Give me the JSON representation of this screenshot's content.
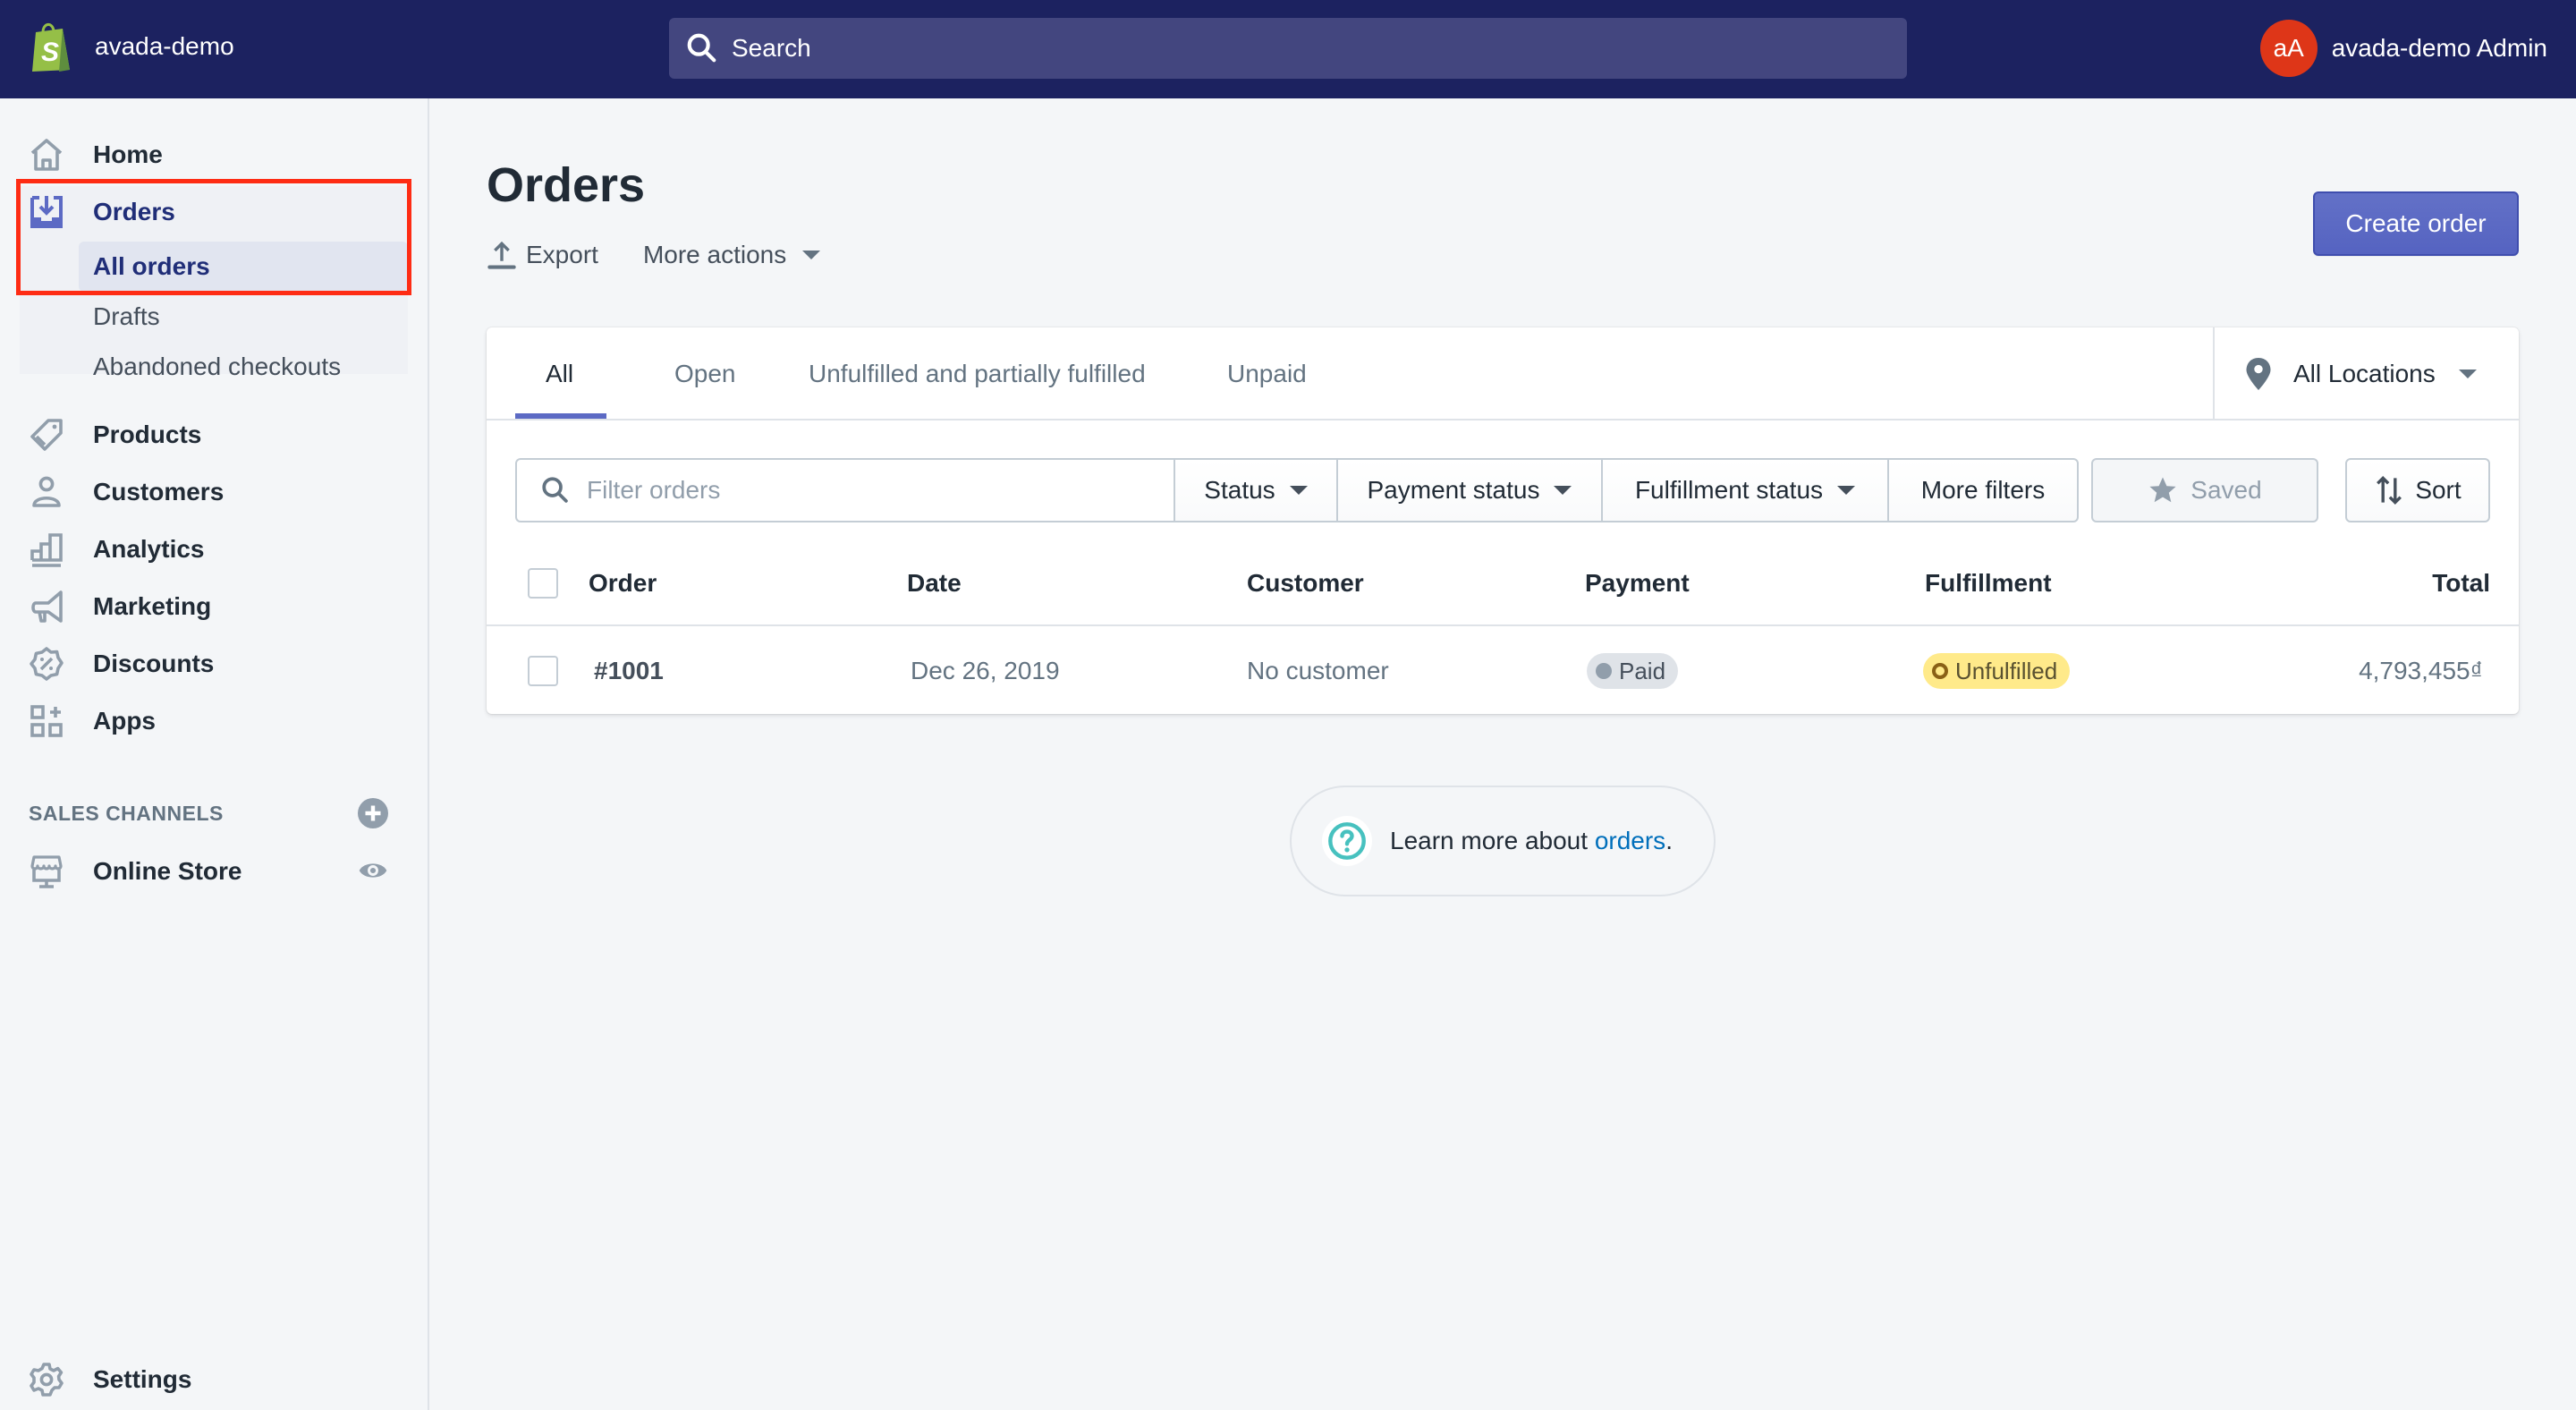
{
  "topbar": {
    "store_name": "avada-demo",
    "search_placeholder": "Search",
    "avatar_initials": "aA",
    "account_name": "avada-demo Admin",
    "colors": {
      "background": "#1c2260",
      "search": "#43467f",
      "avatar": "#de3618"
    }
  },
  "sidebar": {
    "items": [
      {
        "label": "Home",
        "icon": "home-icon"
      },
      {
        "label": "Orders",
        "icon": "orders-icon",
        "active": true
      },
      {
        "label": "Products",
        "icon": "tag-icon"
      },
      {
        "label": "Customers",
        "icon": "person-icon"
      },
      {
        "label": "Analytics",
        "icon": "bar-chart-icon"
      },
      {
        "label": "Marketing",
        "icon": "megaphone-icon"
      },
      {
        "label": "Discounts",
        "icon": "discount-icon"
      },
      {
        "label": "Apps",
        "icon": "apps-icon"
      }
    ],
    "orders_sub": [
      {
        "label": "All orders",
        "selected": true
      },
      {
        "label": "Drafts"
      },
      {
        "label": "Abandoned checkouts"
      }
    ],
    "sales_channels_title": "SALES CHANNELS",
    "channels": [
      {
        "label": "Online Store",
        "icon": "store-icon"
      }
    ],
    "settings_label": "Settings"
  },
  "page": {
    "title": "Orders",
    "export_label": "Export",
    "more_actions_label": "More actions",
    "create_order_label": "Create order",
    "accent_color": "#5c6ac4"
  },
  "tabs": [
    {
      "label": "All",
      "active": true
    },
    {
      "label": "Open"
    },
    {
      "label": "Unfulfilled and partially fulfilled"
    },
    {
      "label": "Unpaid"
    }
  ],
  "location_filter": "All Locations",
  "filters": {
    "search_placeholder": "Filter orders",
    "status": "Status",
    "payment_status": "Payment status",
    "fulfillment_status": "Fulfillment status",
    "more_filters": "More filters",
    "saved": "Saved",
    "sort": "Sort"
  },
  "table": {
    "columns": [
      "Order",
      "Date",
      "Customer",
      "Payment",
      "Fulfillment",
      "Total"
    ],
    "rows": [
      {
        "order": "#1001",
        "date": "Dec 26, 2019",
        "customer": "No customer",
        "payment": "Paid",
        "fulfillment": "Unfulfilled",
        "total": "4,793,455₫"
      }
    ]
  },
  "help": {
    "prefix": "Learn more about ",
    "link": "orders",
    "suffix": "."
  }
}
